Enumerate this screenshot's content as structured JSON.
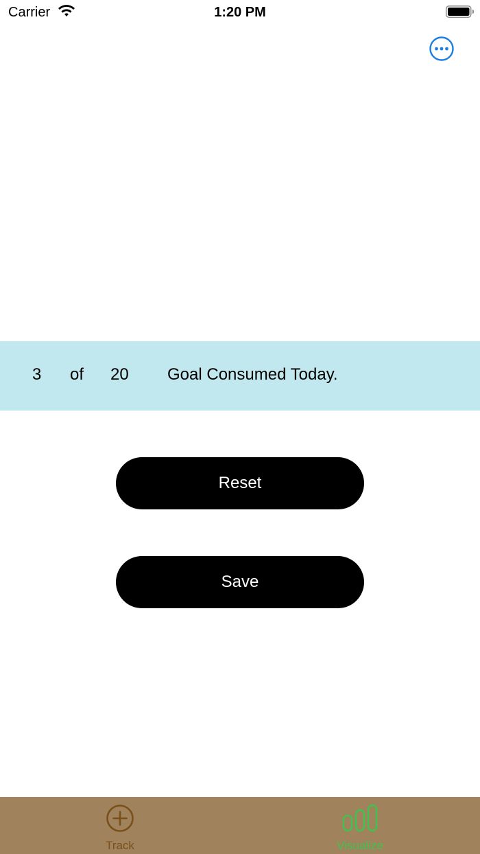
{
  "status_bar": {
    "carrier": "Carrier",
    "time": "1:20 PM"
  },
  "header": {
    "more_icon": "ellipsis-circle-icon",
    "accent_color": "#1a7ee0"
  },
  "progress": {
    "consumed": "3",
    "of_label": "of",
    "goal": "20",
    "caption": "Goal Consumed Today.",
    "banner_color": "#c1e8ee"
  },
  "actions": {
    "reset_label": "Reset",
    "save_label": "Save",
    "button_color": "#000000"
  },
  "tab_bar": {
    "background": "#a0835c",
    "tabs": [
      {
        "label": "Track",
        "icon": "plus-circle-icon",
        "color": "#7a4f1a",
        "selected": false
      },
      {
        "label": "Visualize",
        "icon": "bar-chart-icon",
        "color": "#3fc24f",
        "selected": true
      }
    ]
  }
}
